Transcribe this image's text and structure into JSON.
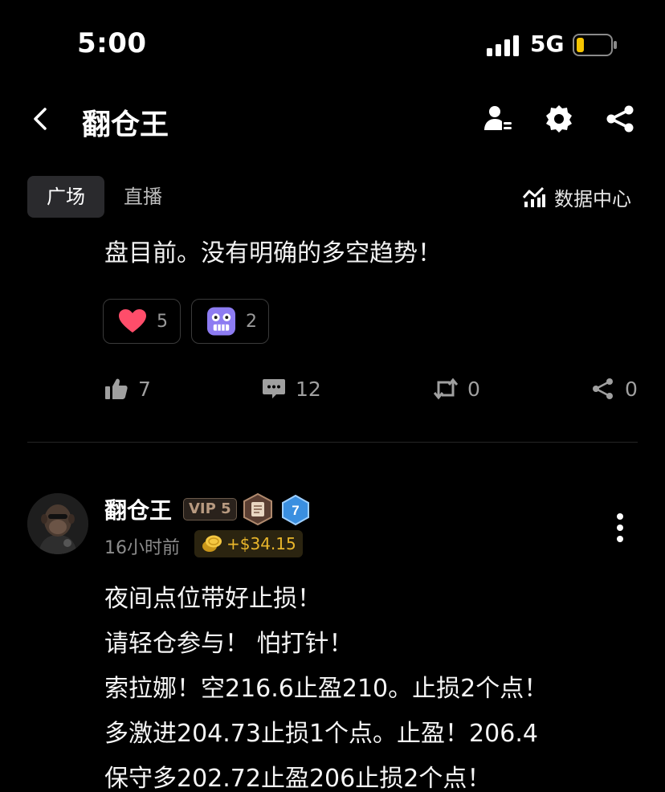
{
  "status_bar": {
    "time": "5:00",
    "network": "5G"
  },
  "header": {
    "title": "翻仓王"
  },
  "tabs": [
    {
      "label": "广场",
      "active": true
    },
    {
      "label": "直播",
      "active": false
    }
  ],
  "data_center_label": "数据中心",
  "previous_post": {
    "text_tail": "盘目前。没有明确的多空趋势！",
    "reactions": [
      {
        "icon": "heart-icon",
        "count": "5"
      },
      {
        "icon": "nervous-face-icon",
        "count": "2"
      }
    ],
    "actions": {
      "likes": "7",
      "comments": "12",
      "reposts": "0",
      "shares": "0"
    }
  },
  "post": {
    "author": "翻仓王",
    "vip": "VIP 5",
    "level": "7",
    "time": "16小时前",
    "tip": "+$34.15",
    "lines": [
      "夜间点位带好止损！",
      "请轻仓参与！ 怕打针！",
      "索拉娜！空216.6止盈210。止损2个点！",
      "多激进204.73止损1个点。止盈！206.4",
      "保守多202.72止盈206止损2个点！"
    ]
  },
  "colors": {
    "background": "#000000",
    "accent_gold": "#e9b62b",
    "heart": "#ff4d6a",
    "battery": "#f5c400"
  }
}
